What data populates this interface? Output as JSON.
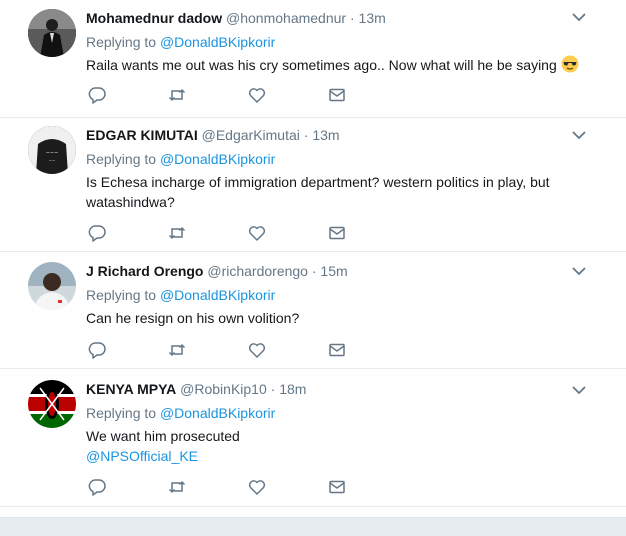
{
  "tweets": [
    {
      "name": "Mohamednur dadow",
      "handle": "@honmohamednur",
      "time": "13m",
      "reply_prefix": "Replying to",
      "reply_to": "@DonaldBKipkorir",
      "text": "Raila wants me out was his cry sometimes ago.. Now what will he be saying",
      "mention": ""
    },
    {
      "name": "EDGAR KIMUTAI",
      "handle": "@EdgarKimutai",
      "time": "13m",
      "reply_prefix": "Replying to",
      "reply_to": "@DonaldBKipkorir",
      "text": "Is Echesa incharge of immigration department? western politics in play, but watashindwa?",
      "mention": ""
    },
    {
      "name": "J Richard Orengo",
      "handle": "@richardorengo",
      "time": "15m",
      "reply_prefix": "Replying to",
      "reply_to": "@DonaldBKipkorir",
      "text": "Can he resign on his own volition?",
      "mention": ""
    },
    {
      "name": "KENYA MPYA",
      "handle": "@RobinKip10",
      "time": "18m",
      "reply_prefix": "Replying to",
      "reply_to": "@DonaldBKipkorir",
      "text": "We want him prosecuted",
      "mention": "@NPSOfficial_KE"
    }
  ],
  "separator": "·",
  "icons": {
    "reply": "reply-icon",
    "retweet": "retweet-icon",
    "like": "heart-icon",
    "dm": "mail-icon",
    "more": "chevron-down-icon",
    "emoji": "sunglasses-emoji"
  },
  "colors": {
    "link": "#1b95e0",
    "muted": "#657786",
    "text": "#14171a",
    "divider": "#e6ecf0"
  }
}
